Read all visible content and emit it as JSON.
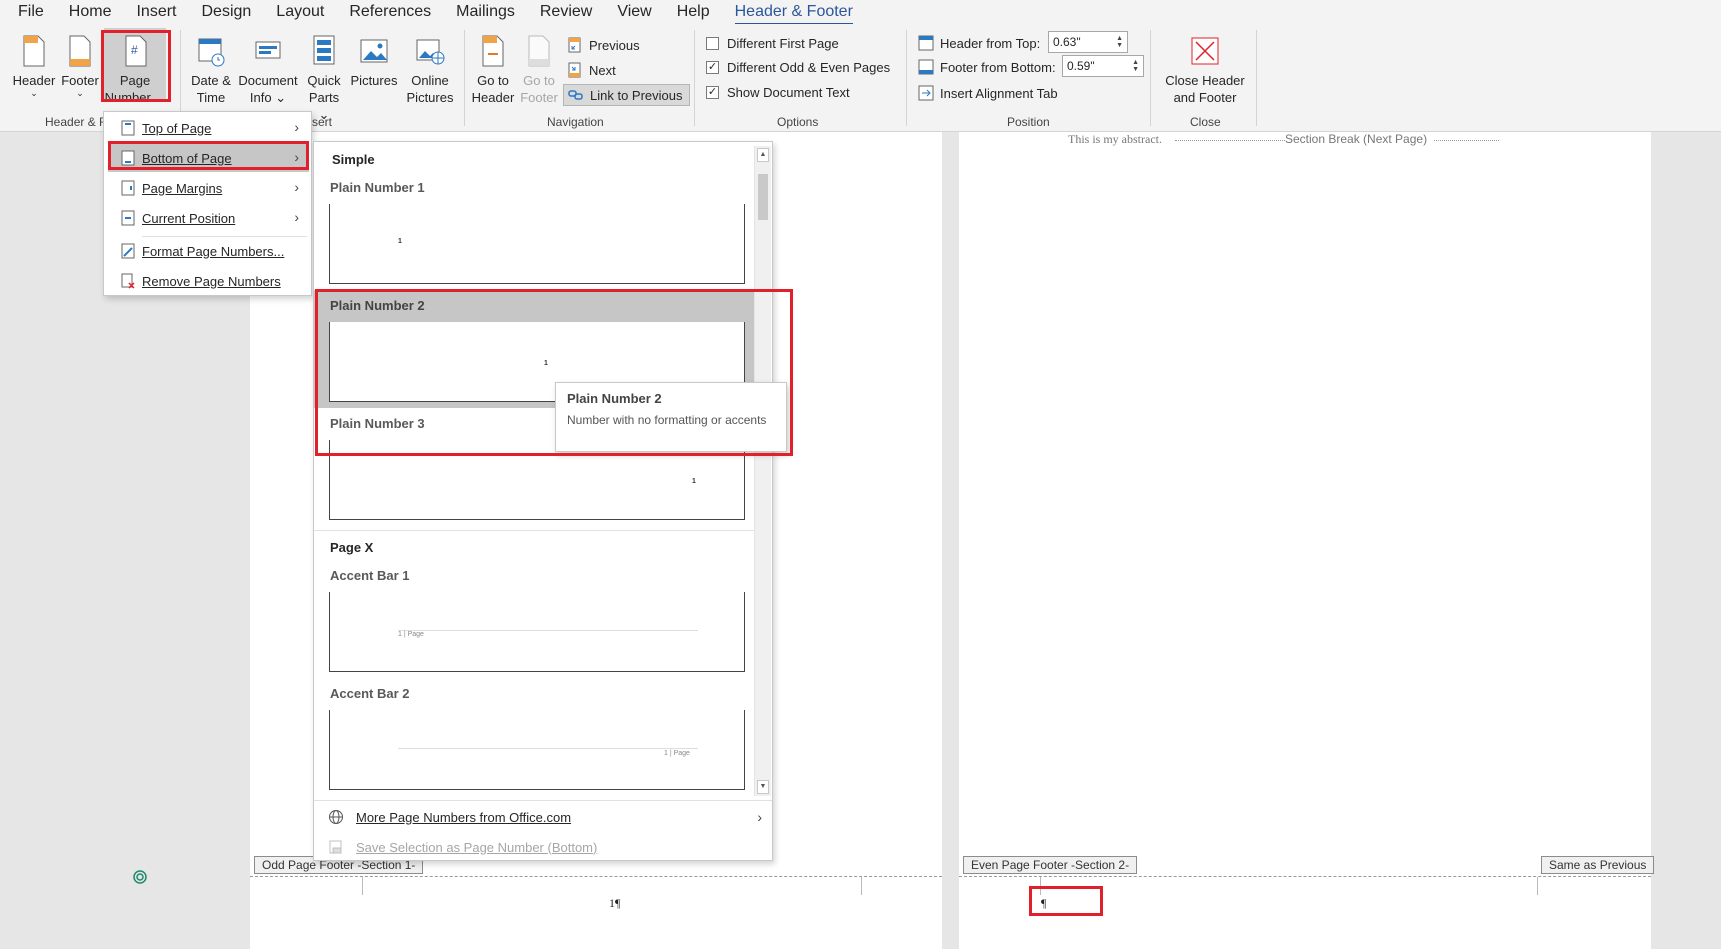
{
  "menu_tabs": [
    "File",
    "Home",
    "Insert",
    "Design",
    "Layout",
    "References",
    "Mailings",
    "Review",
    "View",
    "Help",
    "Header & Footer"
  ],
  "active_tab": "Header & Footer",
  "ribbon": {
    "header_footer_group": {
      "label": "Header & F",
      "header": "Header",
      "footer": "Footer",
      "page_number_l1": "Page",
      "page_number_l2": "Number"
    },
    "insert_group": {
      "label": "sert",
      "date_time_l1": "Date &",
      "date_time_l2": "Time",
      "doc_info_l1": "Document",
      "doc_info_l2": "Info",
      "quick_parts_l1": "Quick",
      "quick_parts_l2": "Parts",
      "pictures": "Pictures",
      "online_pictures_l1": "Online",
      "online_pictures_l2": "Pictures"
    },
    "navigation_group": {
      "label": "Navigation",
      "goto_header_l1": "Go to",
      "goto_header_l2": "Header",
      "goto_footer_l1": "Go to",
      "goto_footer_l2": "Footer",
      "previous": "Previous",
      "next": "Next",
      "link_to_previous": "Link to Previous"
    },
    "options_group": {
      "label": "Options",
      "different_first_page": "Different First Page",
      "different_odd_even": "Different Odd & Even Pages",
      "show_document_text": "Show Document Text"
    },
    "position_group": {
      "label": "Position",
      "header_from_top": "Header from Top:",
      "header_from_top_value": "0.63\"",
      "footer_from_bottom": "Footer from Bottom:",
      "footer_from_bottom_value": "0.59\"",
      "insert_alignment_tab": "Insert Alignment Tab"
    },
    "close_group": {
      "label": "Close",
      "close_l1": "Close Header",
      "close_l2": "and Footer"
    }
  },
  "page_number_menu": {
    "items": [
      "Top of Page",
      "Bottom of Page",
      "Page Margins",
      "Current Position",
      "Format Page Numbers...",
      "Remove Page Numbers"
    ]
  },
  "gallery": {
    "section_simple": "Simple",
    "plain1": "Plain Number 1",
    "plain2": "Plain Number 2",
    "plain3": "Plain Number 3",
    "section_pagex": "Page X",
    "accent1": "Accent Bar 1",
    "accent2": "Accent Bar 2",
    "num": "1",
    "accent_text": "1 | Page",
    "more": "More Page Numbers from Office.com",
    "save_selection": "Save Selection as Page Number (Bottom)"
  },
  "tooltip": {
    "title": "Plain Number 2",
    "desc": "Number with no formatting or accents"
  },
  "document": {
    "abstract_text": "This is my abstract.",
    "section_break": "Section Break (Next Page)",
    "odd_footer_label": "Odd Page Footer -Section 1-",
    "even_footer_label": "Even Page Footer -Section 2-",
    "same_as_previous": "Same as Previous",
    "footer_number": "1¶",
    "pilcrow": "¶"
  },
  "colors": {
    "accent": "#2b579a",
    "highlight_red": "#e0202a"
  }
}
